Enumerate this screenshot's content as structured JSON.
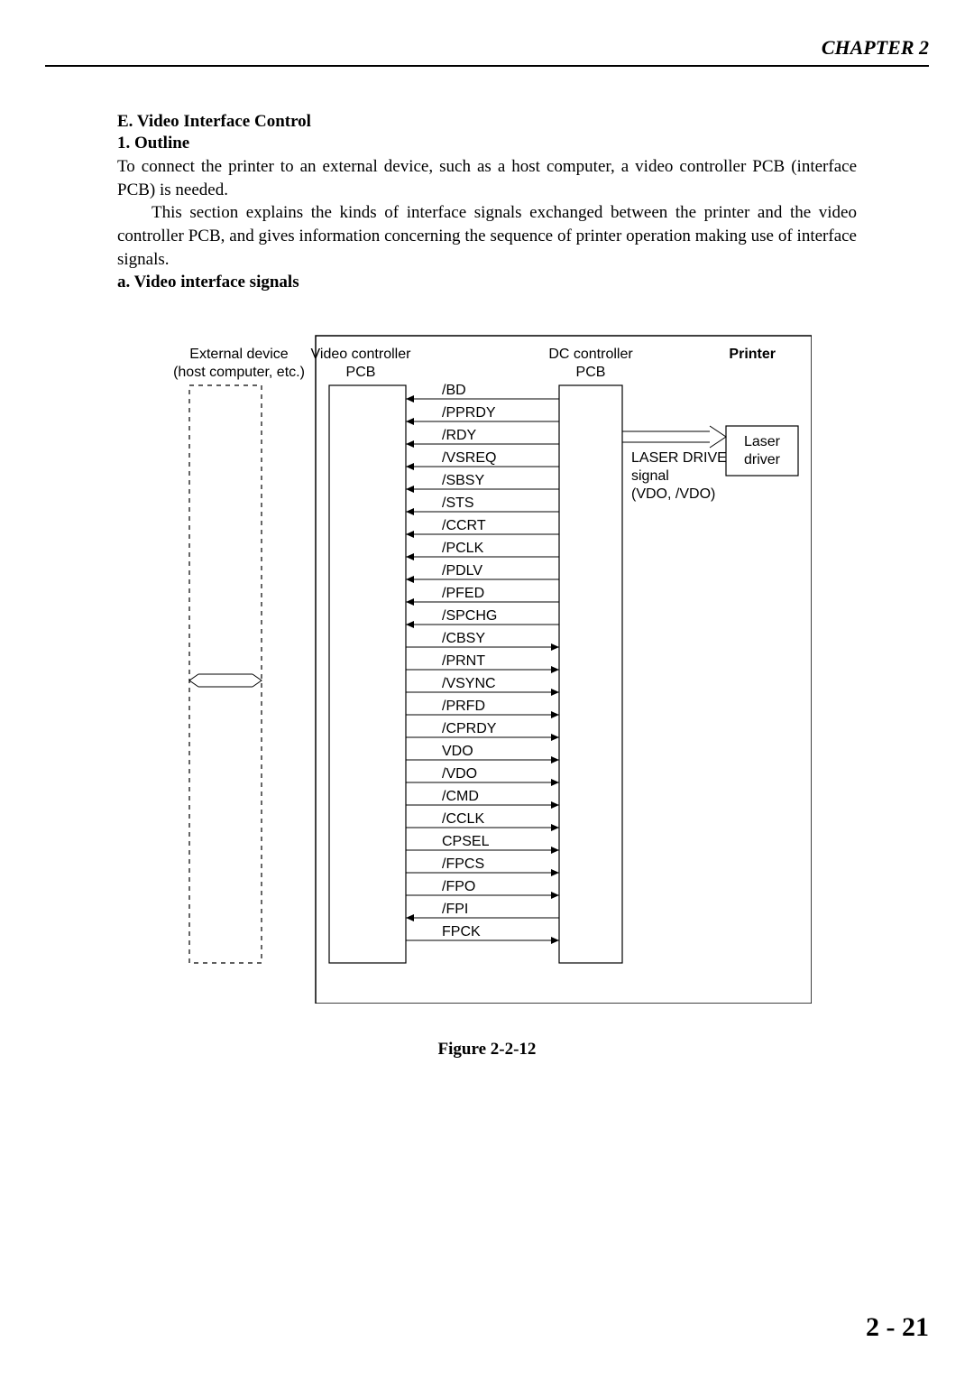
{
  "chapter": "CHAPTER 2",
  "section_e": "E.  Video Interface Control",
  "section_1": "1.  Outline",
  "para1": "To connect the printer to an external device, such as a host computer, a video controller PCB (interface PCB) is needed.",
  "para2": "This section explains the kinds of interface signals exchanged between the printer and the video controller PCB, and gives information concerning the sequence of printer operation making use of interface signals.",
  "section_a": "a.  Video interface signals",
  "figure_caption": "Figure 2-2-12",
  "page_number": "2 - 21",
  "diagram": {
    "external_device_l1": "External device",
    "external_device_l2": "(host computer, etc.)",
    "video_controller_l1": "Video controller",
    "video_controller_l2": "PCB",
    "dc_controller_l1": "DC controller",
    "dc_controller_l2": "PCB",
    "printer": "Printer",
    "laser_driver_l1": "Laser",
    "laser_driver_l2": "driver",
    "laser_drive_l1": "LASER DRIVE",
    "laser_drive_l2": "signal",
    "laser_drive_l3": "(VDO, /VDO)",
    "signals_left": [
      "/BD",
      "/PPRDY",
      "/RDY",
      "/VSREQ",
      "/SBSY",
      "/STS",
      "/CCRT",
      "/PCLK",
      "/PDLV",
      "/PFED",
      "/SPCHG"
    ],
    "signals_right": [
      "/CBSY",
      "/PRNT",
      "/VSYNC",
      "/PRFD",
      "/CPRDY",
      "VDO",
      "/VDO",
      "/CMD",
      "/CCLK",
      "CPSEL",
      "/FPCS",
      "/FPO"
    ],
    "signal_fpi": "/FPI",
    "signal_fpck": "FPCK"
  }
}
